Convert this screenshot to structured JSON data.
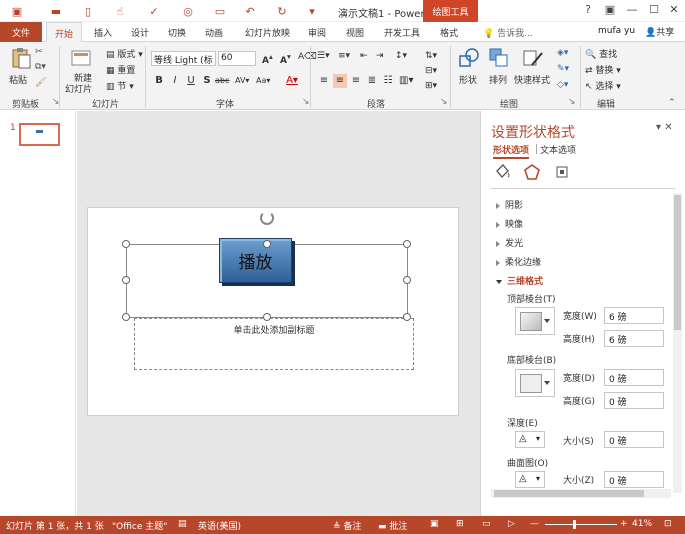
{
  "title_bar": {
    "doc_title": "演示文稿1 - Power...",
    "context_tab": "绘图工具",
    "window_controls": [
      "?",
      "▣",
      "—",
      "☐",
      "✕"
    ]
  },
  "tabs": {
    "file": "文件",
    "items": [
      "开始",
      "插入",
      "设计",
      "切换",
      "动画",
      "幻灯片放映",
      "审阅",
      "视图",
      "开发工具",
      "格式"
    ],
    "tell_me": "告诉我...",
    "user": "mufa yu",
    "share": "共享"
  },
  "ribbon": {
    "clipboard": {
      "paste": "粘贴",
      "label": "剪贴板"
    },
    "slides": {
      "new_slide": "新建",
      "new_slide2": "幻灯片",
      "layout": "版式",
      "reset": "重置",
      "section": "节",
      "label": "幻灯片"
    },
    "font": {
      "font_name": "等线 Light (标",
      "font_size": "60",
      "label": "字体"
    },
    "paragraph": {
      "label": "段落"
    },
    "drawing": {
      "shape": "形状",
      "arrange": "排列",
      "quick_styles": "快速样式",
      "label": "绘图"
    },
    "editing": {
      "find": "查找",
      "replace": "替换",
      "select": "选择",
      "label": "编辑"
    }
  },
  "thumbs": {
    "number": "1"
  },
  "slide": {
    "button_text": "播放",
    "subtitle_placeholder": "单击此处添加副标题"
  },
  "format_pane": {
    "title": "设置形状格式",
    "tab_shape": "形状选项",
    "tab_text": "文本选项",
    "sections": [
      "阴影",
      "映像",
      "发光",
      "柔化边缘"
    ],
    "section_3d": "三维格式",
    "top_bevel": "顶部棱台(T)",
    "width_label": "宽度(W)",
    "width_value": "6 磅",
    "height_label": "高度(H)",
    "height_value": "6 磅",
    "bottom_bevel": "底部棱台(B)",
    "width2_label": "宽度(D)",
    "width2_value": "0 磅",
    "height2_label": "高度(G)",
    "height2_value": "0 磅",
    "depth": "深度(E)",
    "size_label": "大小(S)",
    "depth_value": "0 磅",
    "contour": "曲面图(O)",
    "contour_size_label": "大小(Z)",
    "contour_value": "0 磅"
  },
  "status": {
    "slide_info": "幻灯片 第 1 张，共 1 张",
    "theme": "\"Office 主题\"",
    "language": "英语(美国)",
    "notes": "备注",
    "comments": "批注",
    "zoom": "41%"
  },
  "colors": {
    "accent": "#b7472a",
    "context": "#d04526"
  }
}
